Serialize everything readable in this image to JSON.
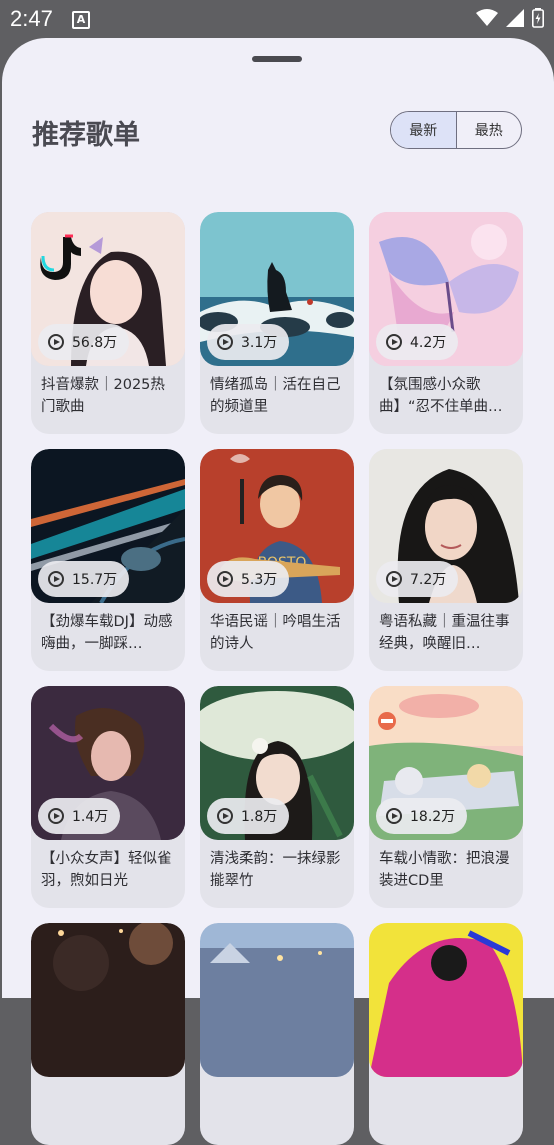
{
  "status": {
    "time": "2:47",
    "notif": "A"
  },
  "header": {
    "title": "推荐歌单"
  },
  "tabs": [
    {
      "label": "最新",
      "active": true
    },
    {
      "label": "最热",
      "active": false
    }
  ],
  "playlists": [
    {
      "plays": "56.8万",
      "title": "抖音爆款｜2025热门歌曲"
    },
    {
      "plays": "3.1万",
      "title": "情绪孤岛｜活在自己的频道里"
    },
    {
      "plays": "4.2万",
      "title": "【氛围感小众歌曲】“忍不住单曲…"
    },
    {
      "plays": "15.7万",
      "title": "【劲爆车载DJ】动感嗨曲，一脚踩…"
    },
    {
      "plays": "5.3万",
      "title": "华语民谣｜吟唱生活的诗人"
    },
    {
      "plays": "7.2万",
      "title": "粤语私藏｜重温往事经典，唤醒旧…"
    },
    {
      "plays": "1.4万",
      "title": "【小众女声】轻似雀羽，煦如日光"
    },
    {
      "plays": "1.8万",
      "title": "清浅柔韵：一抹绿影㨢翠竹"
    },
    {
      "plays": "18.2万",
      "title": "车载小情歌：把浪漫装进CD里"
    }
  ],
  "colors": {
    "sheet": "#f0eff8",
    "card": "#e3e3ea",
    "active_tab": "#dde2f7"
  }
}
